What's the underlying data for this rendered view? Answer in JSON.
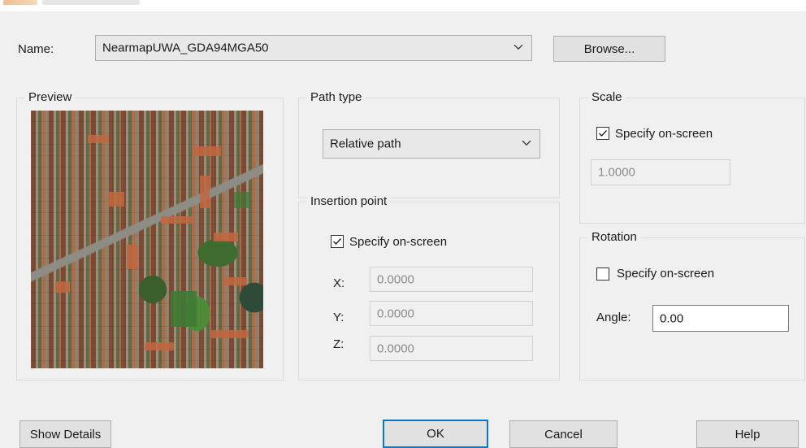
{
  "dialog": {
    "name_label": "Name:",
    "name_value": "NearmapUWA_GDA94MGA50",
    "browse_label": "Browse...",
    "preview_title": "Preview",
    "path_type": {
      "title": "Path type",
      "selected": "Relative path"
    },
    "insertion": {
      "title": "Insertion point",
      "specify_label": "Specify on-screen",
      "specify_checked": true,
      "x_label": "X:",
      "x_value": "0.0000",
      "y_label": "Y:",
      "y_value": "0.0000",
      "z_label": "Z:",
      "z_value": "0.0000"
    },
    "scale": {
      "title": "Scale",
      "specify_label": "Specify on-screen",
      "specify_checked": true,
      "value": "1.0000"
    },
    "rotation": {
      "title": "Rotation",
      "specify_label": "Specify on-screen",
      "specify_checked": false,
      "angle_label": "Angle:",
      "angle_value": "0.00"
    },
    "buttons": {
      "show_details": "Show Details",
      "ok": "OK",
      "cancel": "Cancel",
      "help": "Help"
    }
  },
  "colors": {
    "dialog_bg": "#f0f0f0",
    "button_bg": "#e1e1e1",
    "default_button_border": "#0078d7"
  },
  "icons": [
    "chevron-down-icon",
    "checkmark-icon"
  ]
}
